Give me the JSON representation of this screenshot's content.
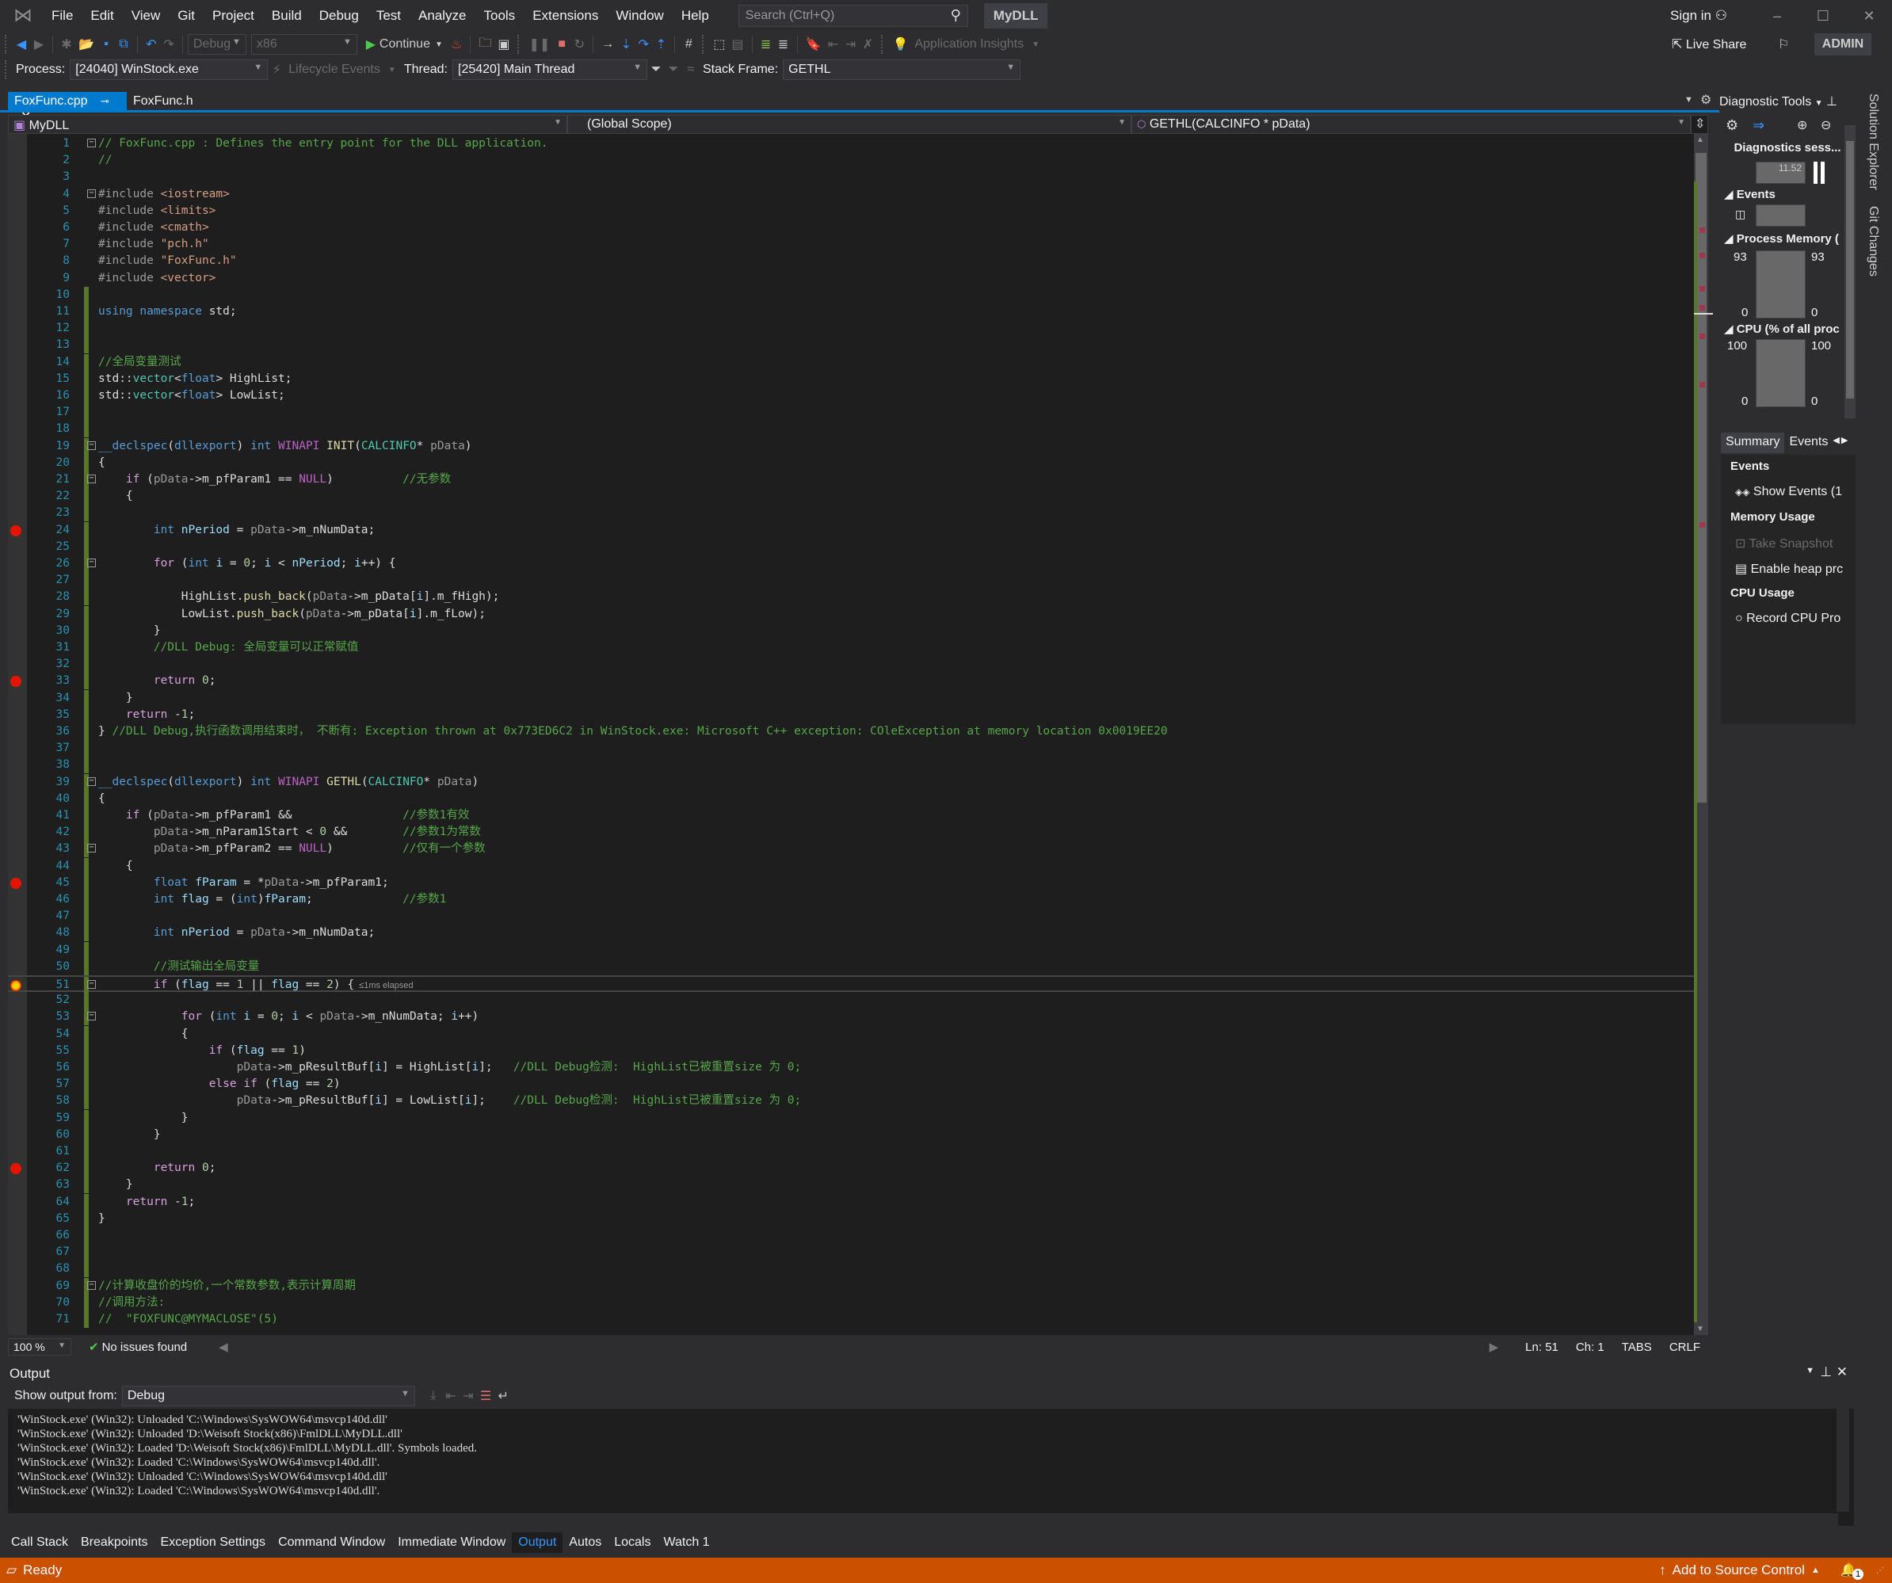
{
  "titlebar": {
    "menu": [
      "File",
      "Edit",
      "View",
      "Git",
      "Project",
      "Build",
      "Debug",
      "Test",
      "Analyze",
      "Tools",
      "Extensions",
      "Window",
      "Help"
    ],
    "search_placeholder": "Search (Ctrl+Q)",
    "solution_name": "MyDLL",
    "sign_in": "Sign in",
    "live_share": "Live Share",
    "user": "ADMIN"
  },
  "toolbar": {
    "config": "Debug",
    "platform": "x86",
    "continue": "Continue",
    "app_insights": "Application Insights",
    "process_label": "Process:",
    "process": "[24040] WinStock.exe",
    "lifecycle": "Lifecycle Events",
    "thread_label": "Thread:",
    "thread": "[25420] Main Thread",
    "stack_label": "Stack Frame:",
    "stack": "GETHL"
  },
  "tabs": [
    {
      "label": "FoxFunc.cpp",
      "active": true
    },
    {
      "label": "FoxFunc.h",
      "active": false
    }
  ],
  "nav": {
    "project": "MyDLL",
    "scope": "(Global Scope)",
    "member": "GETHL(CALCINFO * pData)"
  },
  "editor": {
    "current_line": 51,
    "breakpoints": [
      24,
      33,
      45,
      62
    ],
    "lines": [
      {
        "n": 1,
        "t": "// FoxFunc.cpp : Defines the entry point for the DLL application.",
        "fold": true
      },
      {
        "n": 2,
        "t": "//"
      },
      {
        "n": 3,
        "t": ""
      },
      {
        "n": 4,
        "t": "#include <iostream>",
        "fold": true
      },
      {
        "n": 5,
        "t": "#include <limits>"
      },
      {
        "n": 6,
        "t": "#include <cmath>"
      },
      {
        "n": 7,
        "t": "#include \"pch.h\""
      },
      {
        "n": 8,
        "t": "#include \"FoxFunc.h\""
      },
      {
        "n": 9,
        "t": "#include <vector>"
      },
      {
        "n": 10,
        "t": ""
      },
      {
        "n": 11,
        "t": "using namespace std;"
      },
      {
        "n": 12,
        "t": ""
      },
      {
        "n": 13,
        "t": ""
      },
      {
        "n": 14,
        "t": "//全局变量测试"
      },
      {
        "n": 15,
        "t": "std::vector<float> HighList;"
      },
      {
        "n": 16,
        "t": "std::vector<float> LowList;"
      },
      {
        "n": 17,
        "t": ""
      },
      {
        "n": 18,
        "t": ""
      },
      {
        "n": 19,
        "t": "__declspec(dllexport) int WINAPI INIT(CALCINFO* pData)",
        "fold": true
      },
      {
        "n": 20,
        "t": "{"
      },
      {
        "n": 21,
        "t": "    if (pData->m_pfParam1 == NULL)          //无参数",
        "fold": true
      },
      {
        "n": 22,
        "t": "    {"
      },
      {
        "n": 23,
        "t": ""
      },
      {
        "n": 24,
        "t": "        int nPeriod = pData->m_nNumData;"
      },
      {
        "n": 25,
        "t": ""
      },
      {
        "n": 26,
        "t": "        for (int i = 0; i < nPeriod; i++) {",
        "fold": true
      },
      {
        "n": 27,
        "t": ""
      },
      {
        "n": 28,
        "t": "            HighList.push_back(pData->m_pData[i].m_fHigh);"
      },
      {
        "n": 29,
        "t": "            LowList.push_back(pData->m_pData[i].m_fLow);"
      },
      {
        "n": 30,
        "t": "        }"
      },
      {
        "n": 31,
        "t": "        //DLL Debug: 全局变量可以正常赋值"
      },
      {
        "n": 32,
        "t": ""
      },
      {
        "n": 33,
        "t": "        return 0;"
      },
      {
        "n": 34,
        "t": "    }"
      },
      {
        "n": 35,
        "t": "    return -1;"
      },
      {
        "n": 36,
        "t": "} //DLL Debug,执行函数调用结束时， 不断有: Exception thrown at 0x773ED6C2 in WinStock.exe: Microsoft C++ exception: COleException at memory location 0x0019EE20"
      },
      {
        "n": 37,
        "t": ""
      },
      {
        "n": 38,
        "t": ""
      },
      {
        "n": 39,
        "t": "__declspec(dllexport) int WINAPI GETHL(CALCINFO* pData)",
        "fold": true
      },
      {
        "n": 40,
        "t": "{"
      },
      {
        "n": 41,
        "t": "    if (pData->m_pfParam1 &&                //参数1有效"
      },
      {
        "n": 42,
        "t": "        pData->m_nParam1Start < 0 &&        //参数1为常数"
      },
      {
        "n": 43,
        "t": "        pData->m_pfParam2 == NULL)          //仅有一个参数",
        "fold": true
      },
      {
        "n": 44,
        "t": "    {"
      },
      {
        "n": 45,
        "t": "        float fParam = *pData->m_pfParam1;"
      },
      {
        "n": 46,
        "t": "        int flag = (int)fParam;             //参数1"
      },
      {
        "n": 47,
        "t": ""
      },
      {
        "n": 48,
        "t": "        int nPeriod = pData->m_nNumData;"
      },
      {
        "n": 49,
        "t": ""
      },
      {
        "n": 50,
        "t": "        //测试输出全局变量"
      },
      {
        "n": 51,
        "t": "        if (flag == 1 || flag == 2) {",
        "fold": true,
        "hint": "≤1ms elapsed"
      },
      {
        "n": 52,
        "t": ""
      },
      {
        "n": 53,
        "t": "            for (int i = 0; i < pData->m_nNumData; i++)",
        "fold": true
      },
      {
        "n": 54,
        "t": "            {"
      },
      {
        "n": 55,
        "t": "                if (flag == 1)"
      },
      {
        "n": 56,
        "t": "                    pData->m_pResultBuf[i] = HighList[i];   //DLL Debug检测:  HighList已被重置size 为 0;"
      },
      {
        "n": 57,
        "t": "                else if (flag == 2)"
      },
      {
        "n": 58,
        "t": "                    pData->m_pResultBuf[i] = LowList[i];    //DLL Debug检测:  HighList已被重置size 为 0;"
      },
      {
        "n": 59,
        "t": "            }"
      },
      {
        "n": 60,
        "t": "        }"
      },
      {
        "n": 61,
        "t": ""
      },
      {
        "n": 62,
        "t": "        return 0;"
      },
      {
        "n": 63,
        "t": "    }"
      },
      {
        "n": 64,
        "t": "    return -1;"
      },
      {
        "n": 65,
        "t": "}"
      },
      {
        "n": 66,
        "t": ""
      },
      {
        "n": 67,
        "t": ""
      },
      {
        "n": 68,
        "t": ""
      },
      {
        "n": 69,
        "t": "//计算收盘价的均价,一个常数参数,表示计算周期",
        "fold": true
      },
      {
        "n": 70,
        "t": "//调用方法:"
      },
      {
        "n": 71,
        "t": "//  \"FOXFUNC@MYMACLOSE\"(5)"
      }
    ],
    "status": {
      "zoom": "100 %",
      "issues": "No issues found",
      "ln": "Ln: 51",
      "ch": "Ch: 1",
      "indent": "TABS",
      "eol": "CRLF"
    }
  },
  "diagnostics": {
    "title": "Diagnostic Tools",
    "session": "Diagnostics sess...",
    "timeline_value": "11.52",
    "events_label": "Events",
    "memory_label": "Process Memory (",
    "memory_max": "93",
    "memory_min": "0",
    "cpu_label": "CPU (% of all proc",
    "cpu_max": "100",
    "cpu_min": "0",
    "tabs": [
      "Summary",
      "Events"
    ],
    "summary": {
      "events_header": "Events",
      "show_events": "Show Events (1",
      "memory_header": "Memory Usage",
      "take_snapshot": "Take Snapshot",
      "enable_heap": "Enable heap prc",
      "cpu_header": "CPU Usage",
      "record_cpu": "Record CPU Pro"
    }
  },
  "rightrail": [
    "Solution Explorer",
    "Git Changes"
  ],
  "output": {
    "title": "Output",
    "show_from_label": "Show output from:",
    "source": "Debug",
    "lines": [
      "'WinStock.exe' (Win32): Unloaded 'C:\\Windows\\SysWOW64\\msvcp140d.dll'",
      "'WinStock.exe' (Win32): Unloaded 'D:\\Weisoft Stock(x86)\\FmlDLL\\MyDLL.dll'",
      "'WinStock.exe' (Win32): Loaded 'D:\\Weisoft Stock(x86)\\FmlDLL\\MyDLL.dll'. Symbols loaded.",
      "'WinStock.exe' (Win32): Loaded 'C:\\Windows\\SysWOW64\\msvcp140d.dll'.",
      "'WinStock.exe' (Win32): Unloaded 'C:\\Windows\\SysWOW64\\msvcp140d.dll'",
      "'WinStock.exe' (Win32): Loaded 'C:\\Windows\\SysWOW64\\msvcp140d.dll'."
    ]
  },
  "bottom_tabs": [
    {
      "label": "Call Stack"
    },
    {
      "label": "Breakpoints"
    },
    {
      "label": "Exception Settings"
    },
    {
      "label": "Command Window"
    },
    {
      "label": "Immediate Window"
    },
    {
      "label": "Output",
      "active": true
    },
    {
      "label": "Autos"
    },
    {
      "label": "Locals"
    },
    {
      "label": "Watch 1"
    }
  ],
  "statusbar": {
    "status": "Ready",
    "source_control": "Add to Source Control",
    "notifications": "1",
    "color": "#ca5100"
  }
}
